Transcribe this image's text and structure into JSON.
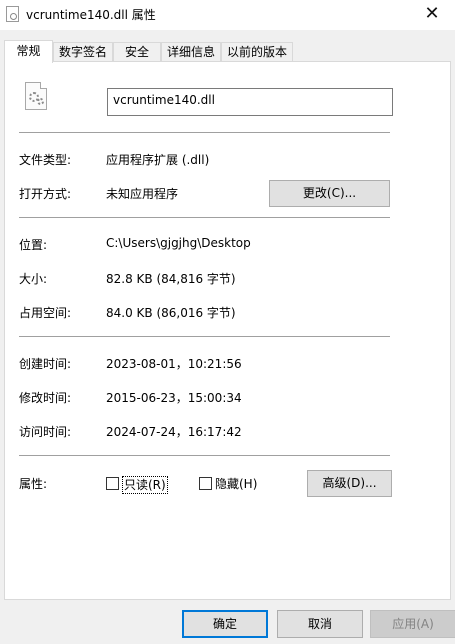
{
  "window": {
    "title": "vcruntime140.dll 属性",
    "close_glyph": "✕"
  },
  "tabs": [
    {
      "label": "常规",
      "active": true
    },
    {
      "label": "数字签名",
      "active": false
    },
    {
      "label": "安全",
      "active": false
    },
    {
      "label": "详细信息",
      "active": false
    },
    {
      "label": "以前的版本",
      "active": false
    }
  ],
  "file": {
    "icon": "gear-file-icon",
    "name": "vcruntime140.dll"
  },
  "general": {
    "type_label": "文件类型:",
    "type_value": "应用程序扩展 (.dll)",
    "opens_label": "打开方式:",
    "opens_value": "未知应用程序",
    "change_button": "更改(C)...",
    "location_label": "位置:",
    "location_value": "C:\\Users\\gjgjhg\\Desktop",
    "size_label": "大小:",
    "size_value": "82.8 KB (84,816 字节)",
    "disk_label": "占用空间:",
    "disk_value": "84.0 KB (86,016 字节)",
    "created_label": "创建时间:",
    "created_value": "2023-08-01，10:21:56",
    "modified_label": "修改时间:",
    "modified_value": "2015-06-23，15:00:34",
    "accessed_label": "访问时间:",
    "accessed_value": "2024-07-24，16:17:42",
    "attributes_label": "属性:",
    "readonly_label": "只读(R)",
    "readonly_checked": false,
    "hidden_label": "隐藏(H)",
    "hidden_checked": false,
    "advanced_button": "高级(D)..."
  },
  "footer": {
    "ok": "确定",
    "cancel": "取消",
    "apply": "应用(A)"
  },
  "colors": {
    "focus_border": "#0078d7",
    "panel_bg": "#ffffff",
    "window_bg": "#f0f0f0"
  }
}
